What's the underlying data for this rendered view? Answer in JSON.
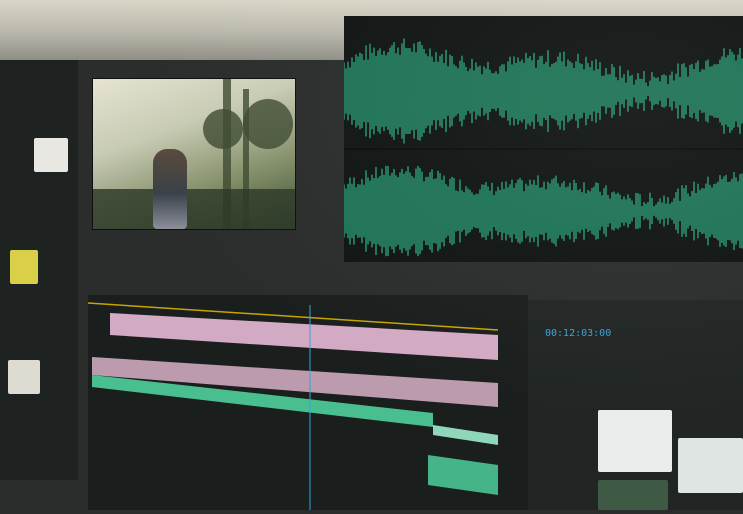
{
  "scene": {
    "description_colors": {
      "waveform": "#2fcf98",
      "timeline_pink": "#e8b9d6",
      "timeline_green": "#4fcf9c",
      "timecode_blue": "#3aa3d8",
      "panel_bg": "#1a1e1d"
    }
  },
  "monitor": {
    "timecode": "00:12:03:00"
  }
}
